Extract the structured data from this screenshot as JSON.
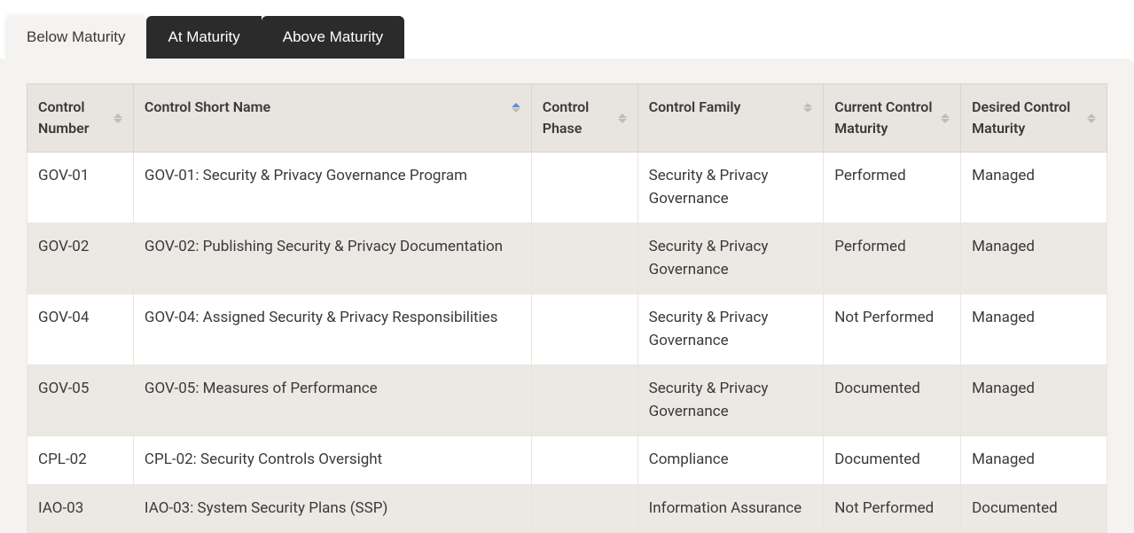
{
  "tabs": [
    {
      "label": "Below Maturity",
      "active": true
    },
    {
      "label": "At Maturity",
      "active": false
    },
    {
      "label": "Above Maturity",
      "active": false
    }
  ],
  "columns": [
    {
      "label": "Control Number",
      "sort": "none"
    },
    {
      "label": "Control Short Name",
      "sort": "asc"
    },
    {
      "label": "Control Phase",
      "sort": "none"
    },
    {
      "label": "Control Family",
      "sort": "none"
    },
    {
      "label": "Current Control Maturity",
      "sort": "none"
    },
    {
      "label": "Desired Control Maturity",
      "sort": "none"
    }
  ],
  "rows": [
    {
      "number": "GOV-01",
      "name": "GOV-01: Security & Privacy Governance Program",
      "phase": "",
      "family": "Security & Privacy Governance",
      "current": "Performed",
      "desired": "Managed"
    },
    {
      "number": "GOV-02",
      "name": "GOV-02: Publishing Security & Privacy Documentation",
      "phase": "",
      "family": "Security & Privacy Governance",
      "current": "Performed",
      "desired": "Managed"
    },
    {
      "number": "GOV-04",
      "name": "GOV-04: Assigned Security & Privacy Responsibilities",
      "phase": "",
      "family": "Security & Privacy Governance",
      "current": "Not Performed",
      "desired": "Managed"
    },
    {
      "number": "GOV-05",
      "name": "GOV-05: Measures of Performance",
      "phase": "",
      "family": "Security & Privacy Governance",
      "current": "Documented",
      "desired": "Managed"
    },
    {
      "number": "CPL-02",
      "name": "CPL-02: Security Controls Oversight",
      "phase": "",
      "family": "Compliance",
      "current": "Documented",
      "desired": "Managed"
    },
    {
      "number": "IAO-03",
      "name": "IAO-03: System Security Plans (SSP)",
      "phase": "",
      "family": "Information Assurance",
      "current": "Not Performed",
      "desired": "Documented"
    }
  ]
}
